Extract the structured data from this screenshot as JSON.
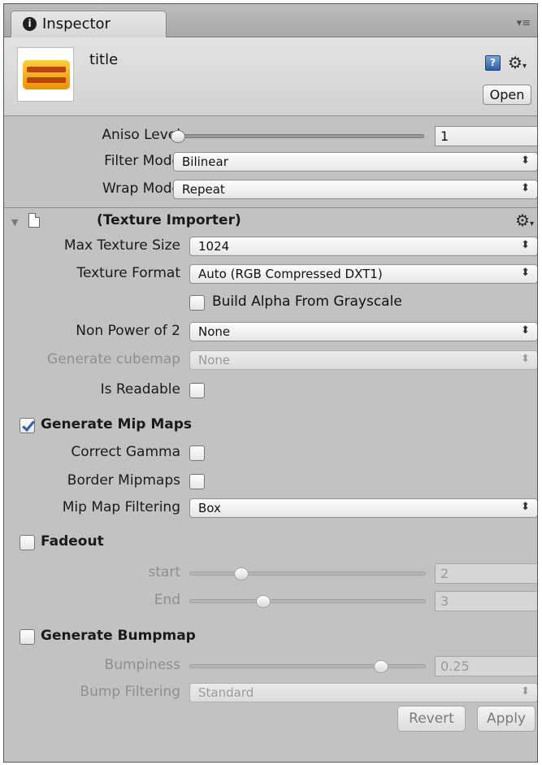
{
  "tab": {
    "label": "Inspector",
    "info_icon": "i",
    "menu_glyph": "▾≡"
  },
  "header": {
    "title": "title",
    "help_icon": "?",
    "gear_glyph": "⚙",
    "open_label": "Open"
  },
  "texture": {
    "aniso_label": "Aniso Level",
    "aniso_value": "1",
    "aniso_level": 0,
    "filter_label": "Filter Mode",
    "filter_value": "Bilinear",
    "wrap_label": "Wrap Mode",
    "wrap_value": "Repeat"
  },
  "importer": {
    "title": "(Texture Importer)",
    "max_size_label": "Max Texture Size",
    "max_size_value": "1024",
    "format_label": "Texture Format",
    "format_value": "Auto (RGB Compressed DXT1)",
    "build_alpha_label": "Build Alpha From Grayscale",
    "build_alpha_checked": false,
    "npot_label": "Non Power of 2",
    "npot_value": "None",
    "cubemap_label": "Generate cubemap",
    "cubemap_value": "None",
    "readable_label": "Is Readable",
    "readable_checked": false,
    "mipmaps_label": "Generate Mip Maps",
    "mipmaps_checked": true,
    "gamma_label": "Correct Gamma",
    "gamma_checked": false,
    "border_label": "Border Mipmaps",
    "border_checked": false,
    "mip_filter_label": "Mip Map Filtering",
    "mip_filter_value": "Box",
    "fadeout_label": "Fadeout",
    "fadeout_checked": false,
    "start_label": "start",
    "start_value": "2",
    "start_fraction": 0.2,
    "end_label": "End",
    "end_value": "3",
    "end_fraction": 0.3,
    "bump_label": "Generate Bumpmap",
    "bump_checked": false,
    "bumpiness_label": "Bumpiness",
    "bumpiness_value": "0.25",
    "bumpiness_fraction": 0.83,
    "bump_filter_label": "Bump Filtering",
    "bump_filter_value": "Standard"
  },
  "footer": {
    "revert_label": "Revert",
    "apply_label": "Apply"
  },
  "popup_arrows": "⬍"
}
